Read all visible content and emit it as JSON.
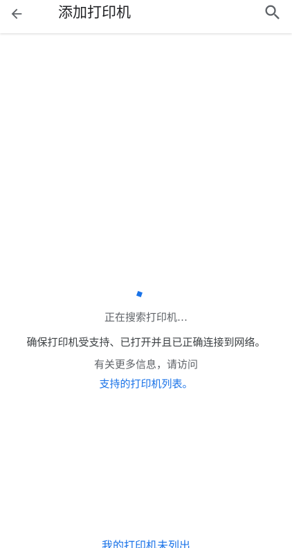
{
  "header": {
    "title": "添加打印机"
  },
  "status": {
    "searching": "正在搜索打印机…",
    "ensure": "确保打印机受支持、已打开并且已正确连接到网络。",
    "more_info": "有关更多信息，请访问",
    "supported_link": "支持的打印机列表。"
  },
  "footer": {
    "not_listed_link": "我的打印机未列出"
  },
  "colors": {
    "accent": "#1a73e8",
    "title_text": "#202124",
    "secondary_text": "#5f6368"
  },
  "icons": {
    "back": "arrow-back-icon",
    "search": "search-icon",
    "loading": "loading-spinner"
  }
}
